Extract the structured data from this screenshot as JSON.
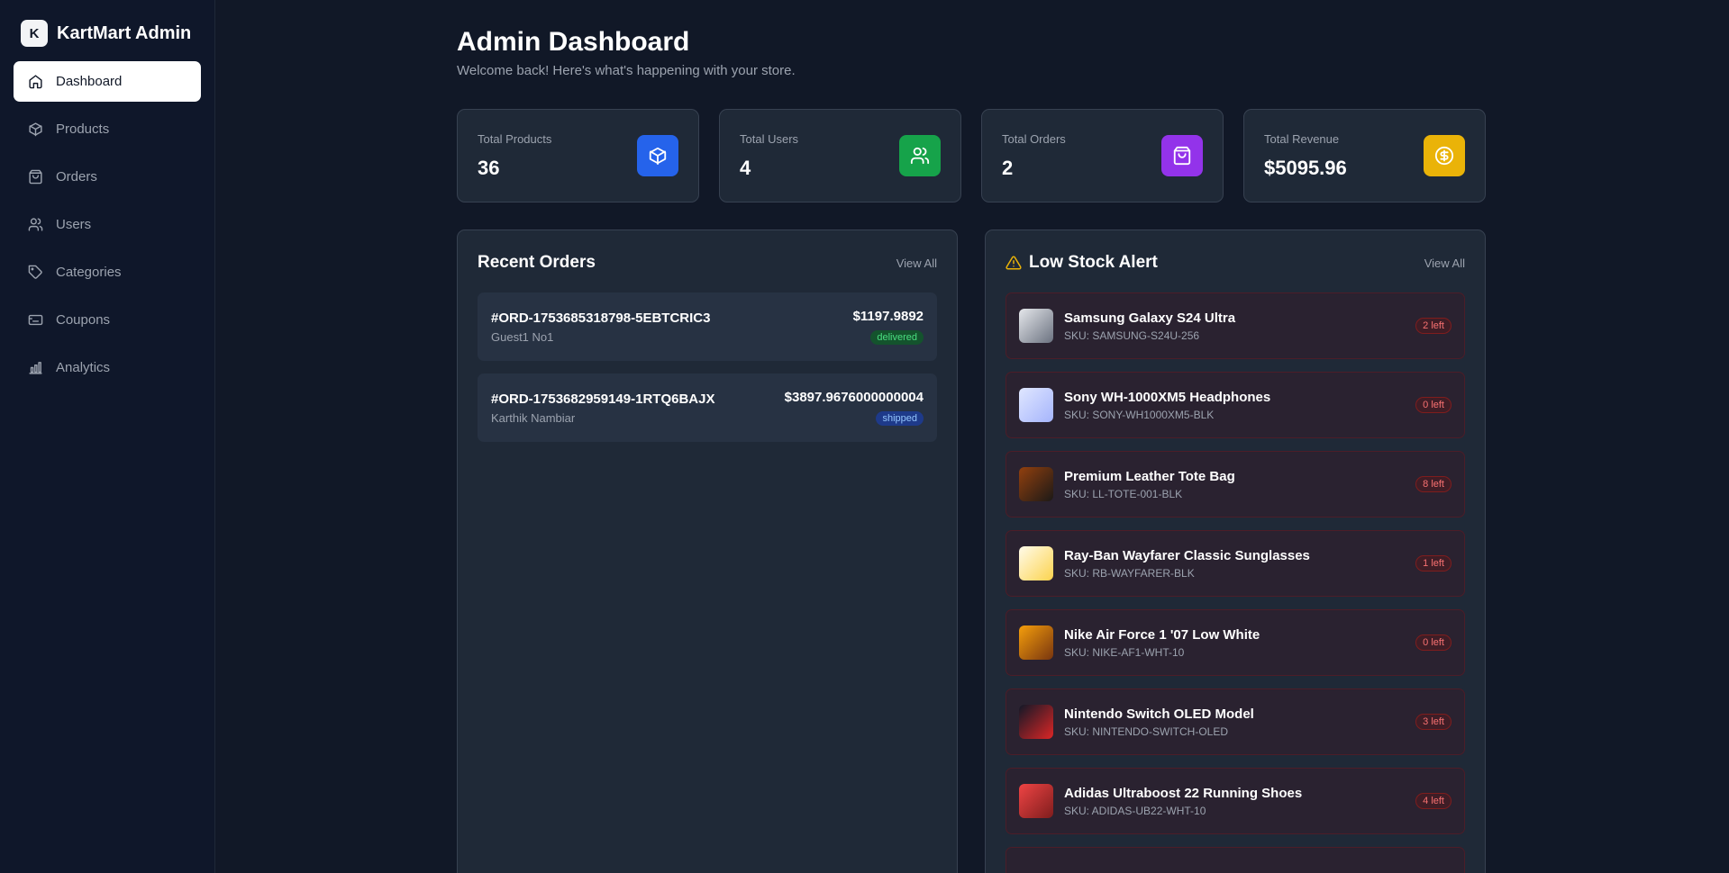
{
  "brand": {
    "logo_letter": "K",
    "name": "KartMart Admin"
  },
  "sidebar": {
    "items": [
      {
        "label": "Dashboard",
        "icon": "home-icon",
        "active": true
      },
      {
        "label": "Products",
        "icon": "box-icon"
      },
      {
        "label": "Orders",
        "icon": "shopping-bag-icon"
      },
      {
        "label": "Users",
        "icon": "users-icon"
      },
      {
        "label": "Categories",
        "icon": "tag-icon"
      },
      {
        "label": "Coupons",
        "icon": "ticket-icon"
      },
      {
        "label": "Analytics",
        "icon": "bar-chart-icon"
      }
    ]
  },
  "header": {
    "title": "Admin Dashboard",
    "subtitle": "Welcome back! Here's what's happening with your store."
  },
  "stats": [
    {
      "label": "Total Products",
      "value": "36",
      "icon": "box-icon",
      "color": "#2563eb"
    },
    {
      "label": "Total Users",
      "value": "4",
      "icon": "users-icon",
      "color": "#16a34a"
    },
    {
      "label": "Total Orders",
      "value": "2",
      "icon": "shopping-bag-icon",
      "color": "#9333ea"
    },
    {
      "label": "Total Revenue",
      "value": "$5095.96",
      "icon": "dollar-icon",
      "color": "#eab308"
    }
  ],
  "recent_orders": {
    "title": "Recent Orders",
    "view_all": "View All",
    "orders": [
      {
        "id": "#ORD-1753685318798-5EBTCRIC3",
        "customer": "Guest1 No1",
        "amount": "$1197.9892",
        "status": "delivered"
      },
      {
        "id": "#ORD-1753682959149-1RTQ6BAJX",
        "customer": "Karthik Nambiar",
        "amount": "$3897.9676000000004",
        "status": "shipped"
      }
    ]
  },
  "low_stock": {
    "title": "Low Stock Alert",
    "view_all": "View All",
    "items": [
      {
        "name": "Samsung Galaxy S24 Ultra",
        "sku": "SKU: SAMSUNG-S24U-256",
        "left": "2 left",
        "thumb": "#9ca3af"
      },
      {
        "name": "Sony WH-1000XM5 Headphones",
        "sku": "SKU: SONY-WH1000XM5-BLK",
        "left": "0 left",
        "thumb": "#c7d2fe"
      },
      {
        "name": "Premium Leather Tote Bag",
        "sku": "SKU: LL-TOTE-001-BLK",
        "left": "8 left",
        "thumb": "#7c2d12"
      },
      {
        "name": "Ray-Ban Wayfarer Classic Sunglasses",
        "sku": "SKU: RB-WAYFARER-BLK",
        "left": "1 left",
        "thumb": "#fde68a"
      },
      {
        "name": "Nike Air Force 1 '07 Low White",
        "sku": "SKU: NIKE-AF1-WHT-10",
        "left": "0 left",
        "thumb": "#d97706"
      },
      {
        "name": "Nintendo Switch OLED Model",
        "sku": "SKU: NINTENDO-SWITCH-OLED",
        "left": "3 left",
        "thumb": "#dc2626"
      },
      {
        "name": "Adidas Ultraboost 22 Running Shoes",
        "sku": "SKU: ADIDAS-UB22-WHT-10",
        "left": "4 left",
        "thumb": "#ef4444"
      }
    ]
  }
}
